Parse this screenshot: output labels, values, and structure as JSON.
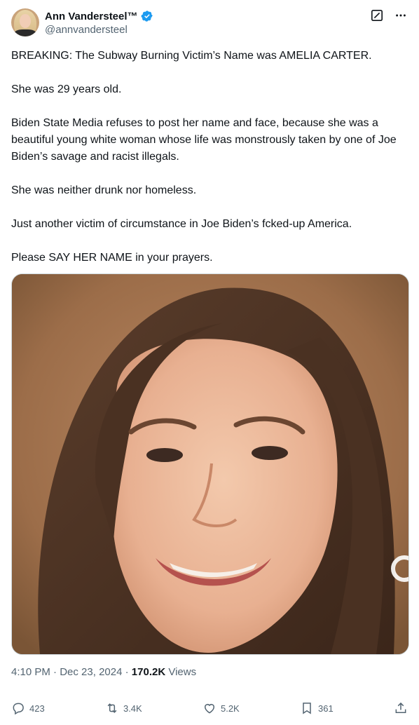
{
  "author": {
    "display_name": "Ann Vandersteel™",
    "handle": "@annvandersteel"
  },
  "tweet": {
    "paragraphs": [
      "BREAKING: The Subway Burning Victim’s Name was AMELIA CARTER.",
      "She was 29 years old.",
      "Biden State Media refuses to post her name and face, because she was a beautiful young white woman whose life was monstrously taken by one of Joe Biden’s savage and racist illegals.",
      "She was neither drunk nor homeless.",
      "Just another victim of circumstance in Joe Biden’s fcked-up America.",
      "Please SAY HER NAME in your prayers."
    ]
  },
  "meta": {
    "time": "4:10 PM",
    "sep1": " · ",
    "date": "Dec 23, 2024",
    "sep2": " · ",
    "views_count": "170.2K",
    "views_label": " Views"
  },
  "actions": {
    "replies": "423",
    "reposts": "3.4K",
    "likes": "5.2K",
    "bookmarks": "361"
  },
  "colors": {
    "verified": "#1d9bf0",
    "secondary_text": "#536471",
    "primary_text": "#0f1419"
  },
  "icons": [
    "verified-badge-icon",
    "grok-icon",
    "more-icon",
    "reply-icon",
    "repost-icon",
    "like-icon",
    "bookmark-icon",
    "share-icon"
  ]
}
